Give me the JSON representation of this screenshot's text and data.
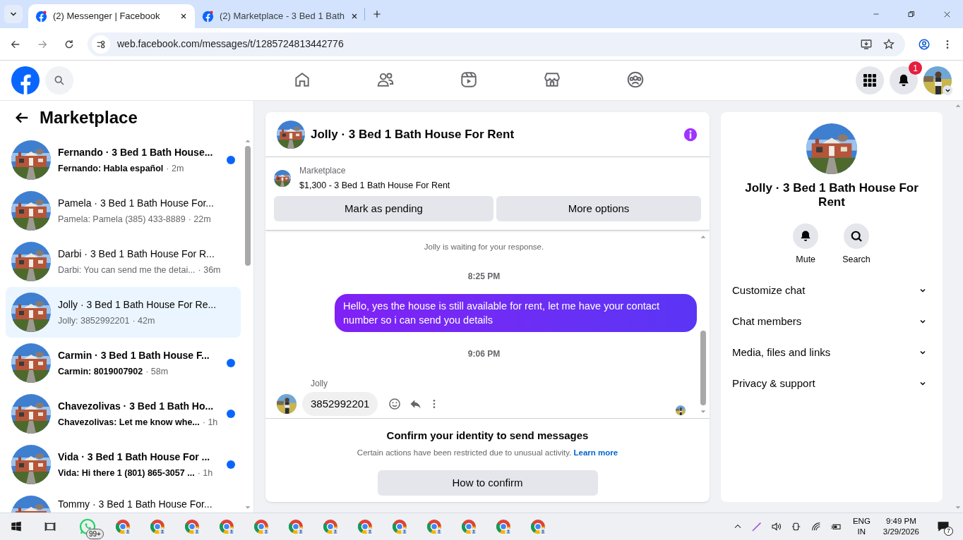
{
  "browser": {
    "tabs": [
      {
        "title": "(2) Messenger | Facebook",
        "selected": true
      },
      {
        "title": "(2) Marketplace - 3 Bed 1 Bath",
        "selected": false
      }
    ],
    "url": "web.facebook.com/messages/t/1285724813442776"
  },
  "top_nav": {
    "notification_count": "1"
  },
  "sidebar": {
    "title": "Marketplace",
    "conversations": [
      {
        "name": "Fernando · 3 Bed 1 Bath House...",
        "preview": "Fernando: Habla español",
        "time": "· 2m",
        "unread": true,
        "selected": false
      },
      {
        "name": "Pamela · 3 Bed 1 Bath House For...",
        "preview": "Pamela: Pamela (385) 433-8889",
        "time": "· 22m",
        "unread": false,
        "selected": false
      },
      {
        "name": "Darbi · 3 Bed 1 Bath House For R...",
        "preview": "Darbi: You can send me the detai...",
        "time": "· 36m",
        "unread": false,
        "selected": false
      },
      {
        "name": "Jolly · 3 Bed 1 Bath House For Re...",
        "preview": "Jolly: 3852992201",
        "time": "· 42m",
        "unread": false,
        "selected": true
      },
      {
        "name": "Carmin · 3 Bed 1 Bath House F...",
        "preview": "Carmin: 8019007902",
        "time": "· 58m",
        "unread": true,
        "selected": false
      },
      {
        "name": "Chavezolivas · 3 Bed 1 Bath Ho...",
        "preview": "Chavezolivas: Let me know whe...",
        "time": "· 1h",
        "unread": true,
        "selected": false
      },
      {
        "name": "Vida · 3 Bed 1 Bath House For ...",
        "preview": "Vida: Hi there 1 (801) 865-3057 ...",
        "time": "· 1h",
        "unread": true,
        "selected": false
      },
      {
        "name": "Tommy · 3 Bed 1 Bath House For...",
        "unread": false,
        "selected": false
      }
    ]
  },
  "chat": {
    "title": "Jolly · 3 Bed 1 Bath House For Rent",
    "listing": {
      "label": "Marketplace",
      "text": "$1,300 - 3 Bed 1 Bath House For Rent"
    },
    "buttons": [
      "Mark as pending",
      "More options"
    ],
    "messages": [
      {
        "kind": "status",
        "text": "Jolly is waiting for your response."
      },
      {
        "kind": "time",
        "text": "8:25 PM"
      },
      {
        "kind": "outgoing",
        "text": "Hello, yes the house is still available for rent, let me have your contact number so i can send you  details"
      },
      {
        "kind": "time",
        "text": "9:06 PM"
      },
      {
        "kind": "incoming",
        "sender": "Jolly",
        "text": "3852992201"
      }
    ],
    "notice": {
      "title": "Confirm your identity to send messages",
      "text": "Certain actions have been restricted due to unusual activity.",
      "link": "Learn more",
      "button": "How to confirm"
    }
  },
  "info_panel": {
    "title": "Jolly · 3 Bed 1 Bath House For Rent",
    "actions": [
      {
        "kind": "mute",
        "label": "Mute"
      },
      {
        "kind": "search",
        "label": "Search"
      }
    ],
    "sections": [
      "Customize chat",
      "Chat members",
      "Media, files and links",
      "Privacy & support"
    ]
  },
  "taskbar": {
    "whatsapp_badge": "99+",
    "language": "ENG",
    "region": "IN",
    "time": "9:49 PM",
    "date": "3/29/2026",
    "notification_count": "7"
  }
}
